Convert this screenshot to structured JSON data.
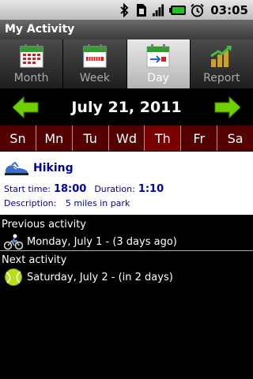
{
  "status": {
    "time": "03:05",
    "icons": [
      "bluetooth-icon",
      "sim-icon",
      "signal-icon",
      "battery-icon",
      "alarm-icon"
    ],
    "battery_color": "#22c022"
  },
  "app": {
    "title": "My Activity"
  },
  "tabs": [
    {
      "label": "Month",
      "icon": "calendar-month-icon",
      "active": false
    },
    {
      "label": "Week",
      "icon": "calendar-week-icon",
      "active": false
    },
    {
      "label": "Day",
      "icon": "calendar-day-icon",
      "active": true
    },
    {
      "label": "Report",
      "icon": "report-chart-icon",
      "active": false
    }
  ],
  "datenav": {
    "date": "July 21, 2011",
    "prev_icon": "left-arrow-icon",
    "next_icon": "right-arrow-icon",
    "arrow_color": "#6fd000"
  },
  "weekdays": {
    "labels": [
      "Sn",
      "Mn",
      "Tu",
      "Wd",
      "Th",
      "Fr",
      "Sa"
    ],
    "selected": "Th",
    "strip_color": "#540000",
    "selected_color": "#7a0000"
  },
  "activity": {
    "name": "Hiking",
    "icon": "shoe-icon",
    "start_label": "Start time:",
    "start_value": "18:00",
    "duration_label": "Duration:",
    "duration_value": "1:10",
    "description_label": "Description:",
    "description_value": "5 miles in park",
    "text_color": "#0000aa"
  },
  "previous": {
    "title": "Previous activity",
    "icon": "cycling-icon",
    "text": "Monday, July 1  -  (3 days ago)"
  },
  "next": {
    "title": "Next activity",
    "icon": "tennis-ball-icon",
    "text": "Saturday, July 2  -  (in 2 days)"
  }
}
